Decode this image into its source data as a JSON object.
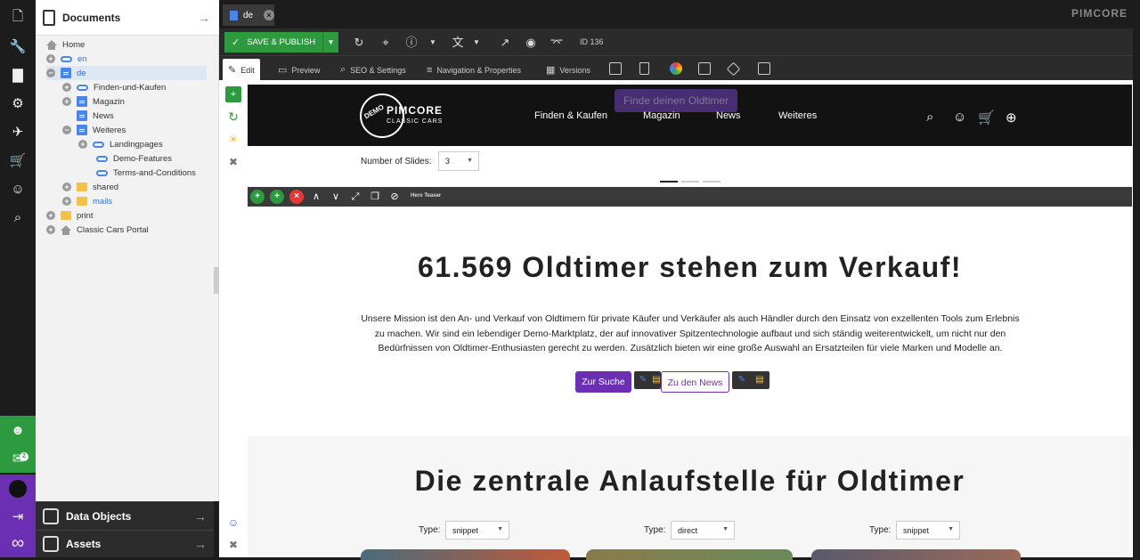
{
  "rail": {
    "notification_count": "2"
  },
  "tree": {
    "title": "Documents",
    "nodes": [
      {
        "label": "Home"
      },
      {
        "label": "en"
      },
      {
        "label": "de"
      },
      {
        "label": "Finden-und-Kaufen"
      },
      {
        "label": "Magazin"
      },
      {
        "label": "News"
      },
      {
        "label": "Weiteres"
      },
      {
        "label": "Landingpages"
      },
      {
        "label": "Demo-Features"
      },
      {
        "label": "Terms-and-Conditions"
      },
      {
        "label": "shared"
      },
      {
        "label": "mails"
      },
      {
        "label": "print"
      },
      {
        "label": "Classic Cars Portal"
      }
    ]
  },
  "bottom_panels": {
    "data_objects": "Data Objects",
    "assets": "Assets"
  },
  "tabbar": {
    "tab_label": "de",
    "logo": "PIMCORE"
  },
  "toolbar": {
    "save_publish": "SAVE & PUBLISH",
    "doc_id": "ID 136"
  },
  "subtabs": {
    "edit": "Edit",
    "preview": "Preview",
    "seo": "SEO & Settings",
    "navigation": "Navigation & Properties",
    "versions": "Versions"
  },
  "page_header": {
    "bg_search": "Finde deinen Oldtimer",
    "brand_demo": "DEMO",
    "brand_name": "PIMCORE",
    "brand_sub": "CLASSIC CARS",
    "nav": [
      "Finden & Kaufen",
      "Magazin",
      "News",
      "Weiteres"
    ]
  },
  "slides": {
    "label": "Number of Slides:",
    "value": "3"
  },
  "block": {
    "name": "Hero Teaser"
  },
  "hero": {
    "title": "61.569 Oldtimer stehen zum Verkauf!",
    "text": "Unsere Mission ist den An- und Verkauf von Oldtimern für private Käufer und Verkäufer als auch Händler durch den Einsatz von exzellenten Tools zum Erlebnis zu machen. Wir sind ein lebendiger Demo-Marktplatz, der auf innovativer Spitzentechnologie aufbaut und sich ständig weiterentwickelt, um nicht nur den Bedürfnissen von Oldtimer-Enthusiasten gerecht zu werden. Zusätzlich bieten wir eine große Auswahl an Ersatzteilen für viele Marken und Modelle an.",
    "btn_search": "Zur Suche",
    "btn_news": "Zu den News"
  },
  "section2": {
    "title": "Die zentrale Anlaufstelle für Oldtimer",
    "type_label": "Type:",
    "types": [
      "snippet",
      "direct",
      "snippet"
    ]
  },
  "colors": {
    "accent_purple": "#6b2fb3",
    "success_green": "#2e9a3f",
    "dark_bg": "#1c1c1c"
  }
}
